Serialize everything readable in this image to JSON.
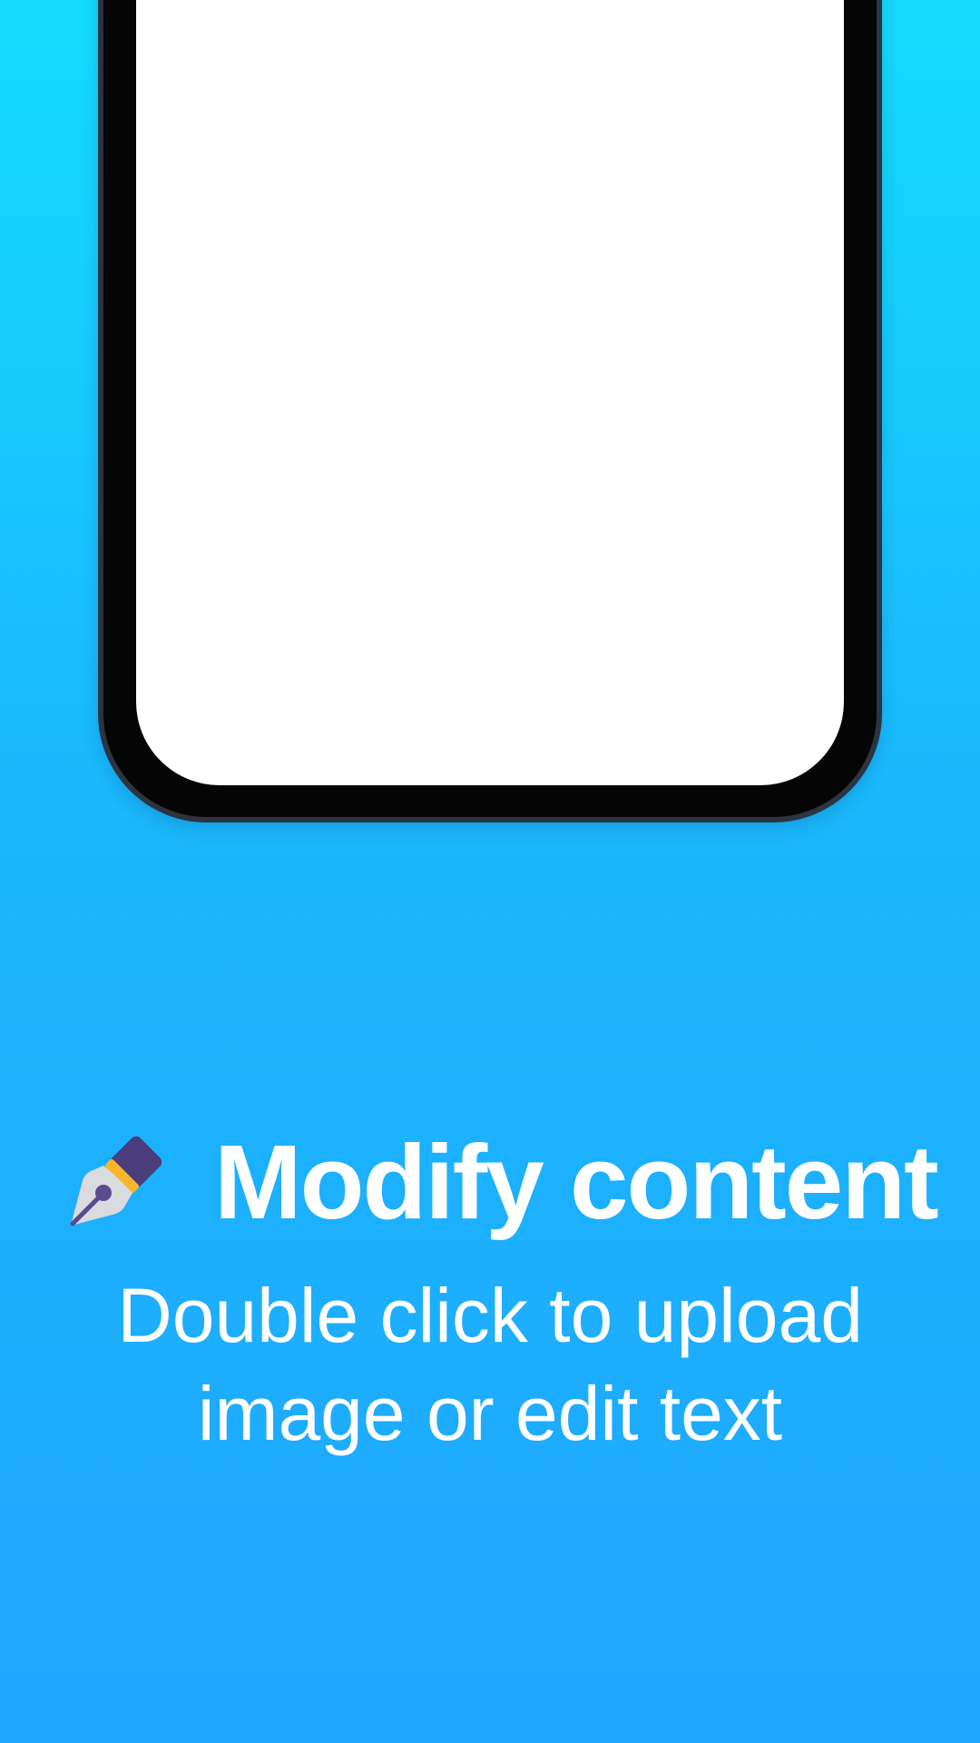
{
  "colors": {
    "background_top": "#14dbfd",
    "background_bottom": "#1fa6fe",
    "phone_bezel": "#050505",
    "phone_screen": "#ffffff",
    "text": "#ffffff"
  },
  "hero": {
    "icon": "fountain-pen-icon",
    "title": "Modify content",
    "subtitle_lines": [
      "Double click to upload",
      "image or edit text"
    ]
  }
}
